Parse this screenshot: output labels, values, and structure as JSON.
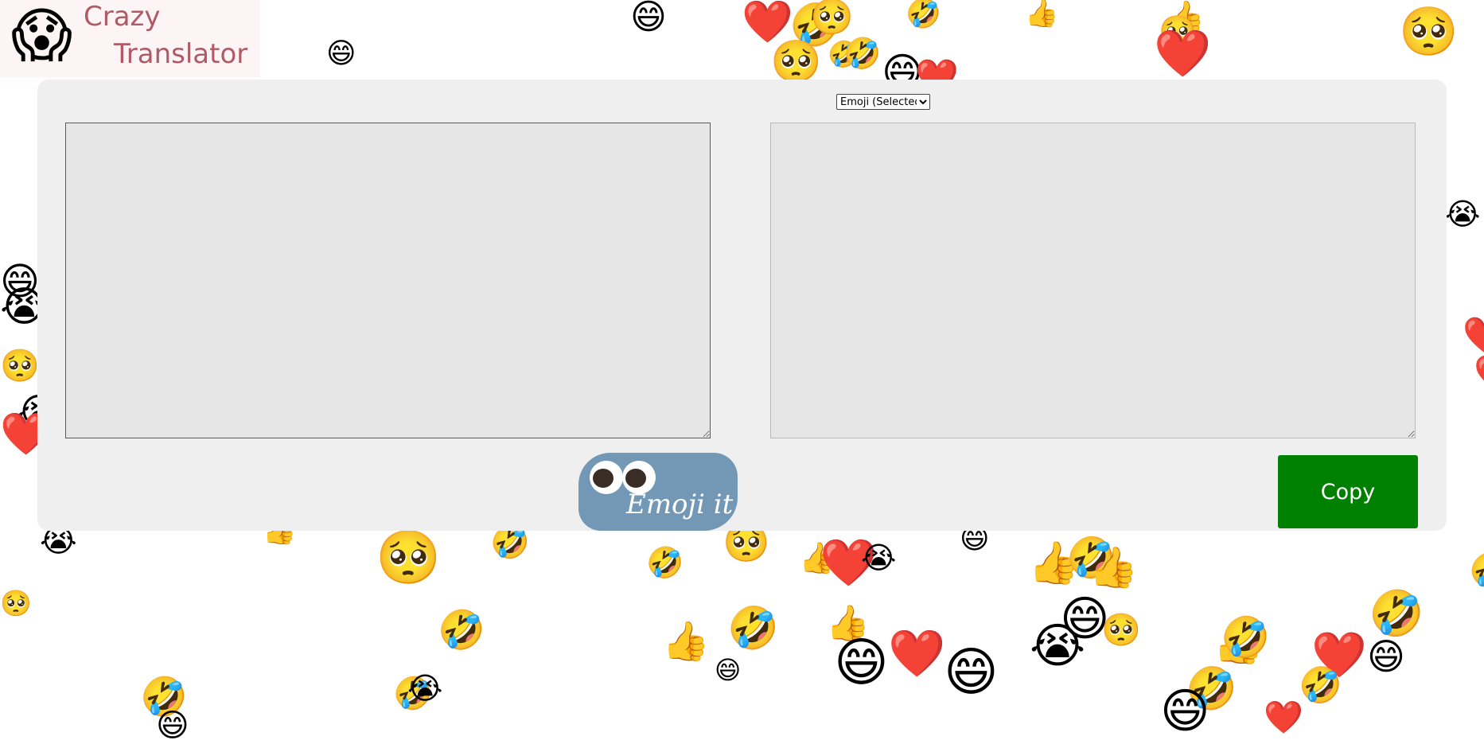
{
  "logo": {
    "line1": "Crazy",
    "line2": "Translator",
    "mascot": "😱"
  },
  "language_select": {
    "selected": "Emoji (Selected)",
    "options": [
      "Emoji (Selected)"
    ]
  },
  "input": {
    "value": "",
    "placeholder": ""
  },
  "output": {
    "value": "",
    "placeholder": ""
  },
  "emoji_button": {
    "label": "Emoji it"
  },
  "copy_button": {
    "label": "Copy",
    "color": "#008000"
  },
  "background": {
    "emojis": [
      "😄",
      "❤️",
      "🤣",
      "🥺",
      "👍",
      "😭"
    ]
  }
}
